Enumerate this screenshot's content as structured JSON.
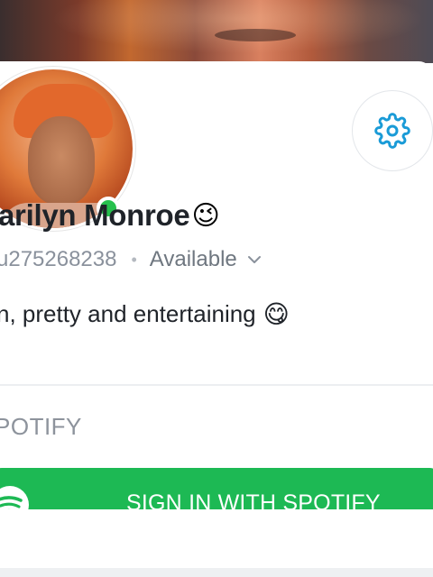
{
  "profile": {
    "display_name": "arilyn Monroe",
    "name_emoji": "😉",
    "username": "u275268238",
    "separator": "•",
    "status": "Available",
    "bio": "n, pretty and entertaining",
    "bio_emoji": "😋",
    "online": true
  },
  "section": {
    "title": "POTIFY"
  },
  "spotify": {
    "button_label": "SIGN IN WITH SPOTIFY"
  },
  "icons": {
    "settings": "gear-icon",
    "status_dropdown": "chevron-down-icon",
    "spotify": "spotify-icon"
  },
  "colors": {
    "accent": "#1a9bd7",
    "online": "#26c04d",
    "spotify_green": "#1db954",
    "text_primary": "#1f2329",
    "text_secondary": "#8a919c"
  }
}
